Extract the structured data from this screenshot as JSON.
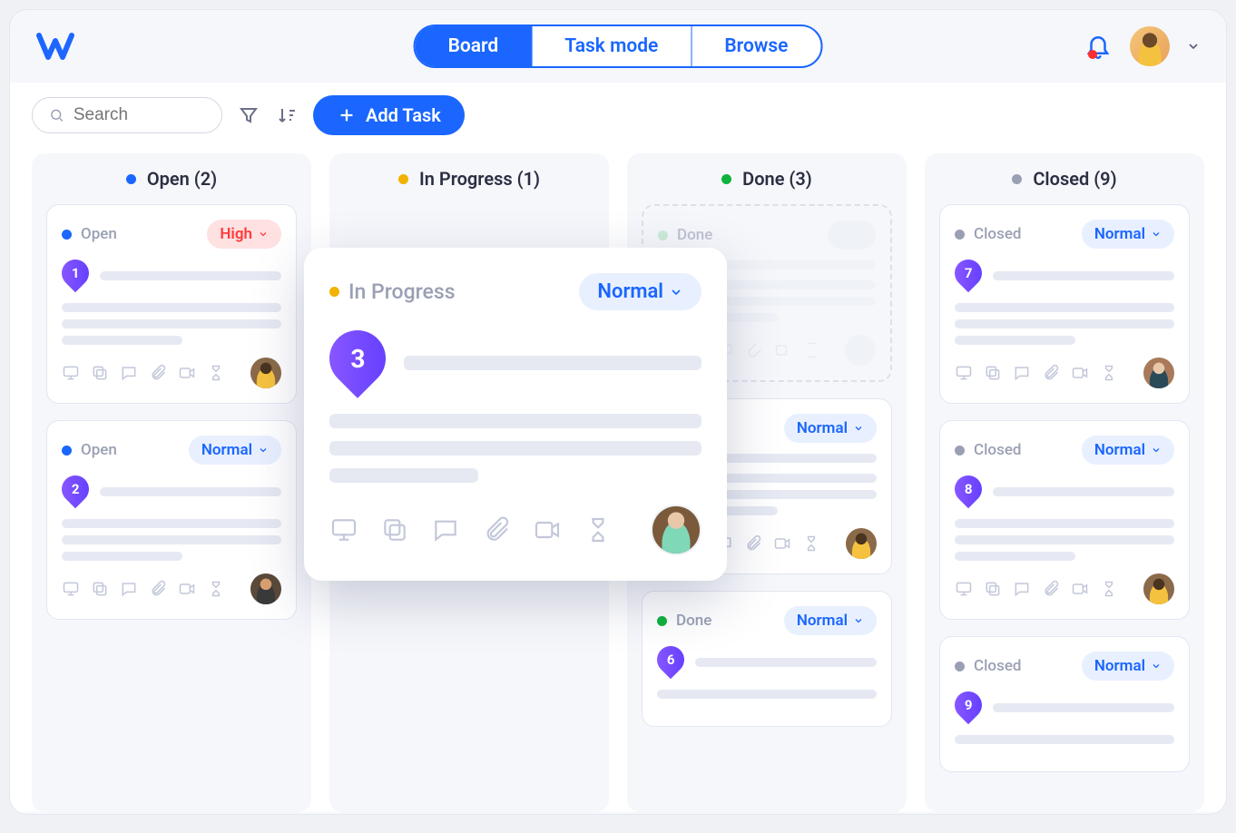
{
  "nav": {
    "board": "Board",
    "task_mode": "Task mode",
    "browse": "Browse"
  },
  "toolbar": {
    "search_placeholder": "Search",
    "add_task": "Add Task"
  },
  "columns": {
    "open": {
      "label": "Open (2)",
      "status_text": "Open"
    },
    "progress": {
      "label": "In Progress (1)",
      "status_text": "In Progress"
    },
    "done": {
      "label": "Done (3)",
      "status_text": "Done"
    },
    "closed": {
      "label": "Closed (9)",
      "status_text": "Closed"
    }
  },
  "priority": {
    "high": "High",
    "normal": "Normal"
  },
  "cards": {
    "c1": {
      "num": "1"
    },
    "c2": {
      "num": "2"
    },
    "c3": {
      "num": "3"
    },
    "c6": {
      "num": "6"
    },
    "c7": {
      "num": "7"
    },
    "c8": {
      "num": "8"
    },
    "c9": {
      "num": "9"
    }
  }
}
